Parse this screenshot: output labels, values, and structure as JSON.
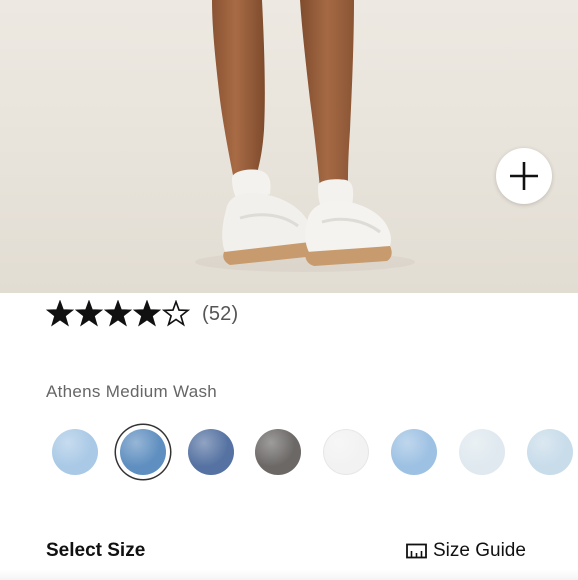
{
  "product_image": {
    "zoom_button_icon": "plus-icon"
  },
  "rating": {
    "value": 4,
    "max": 5,
    "count_text": "(52)"
  },
  "color": {
    "selected_name": "Athens Medium Wash",
    "selected_index": 1,
    "swatches": [
      {
        "color": "#a9c9e6"
      },
      {
        "color": "#5f8fc0"
      },
      {
        "color": "#5572a2"
      },
      {
        "color": "#6b6866"
      },
      {
        "color": "#f2f2f2"
      },
      {
        "color": "#9dc1e3"
      },
      {
        "color": "#dfe9ef"
      },
      {
        "color": "#c8dcea"
      }
    ]
  },
  "size": {
    "label": "Select Size",
    "guide_label": "Size Guide",
    "guide_icon": "ruler-icon"
  }
}
